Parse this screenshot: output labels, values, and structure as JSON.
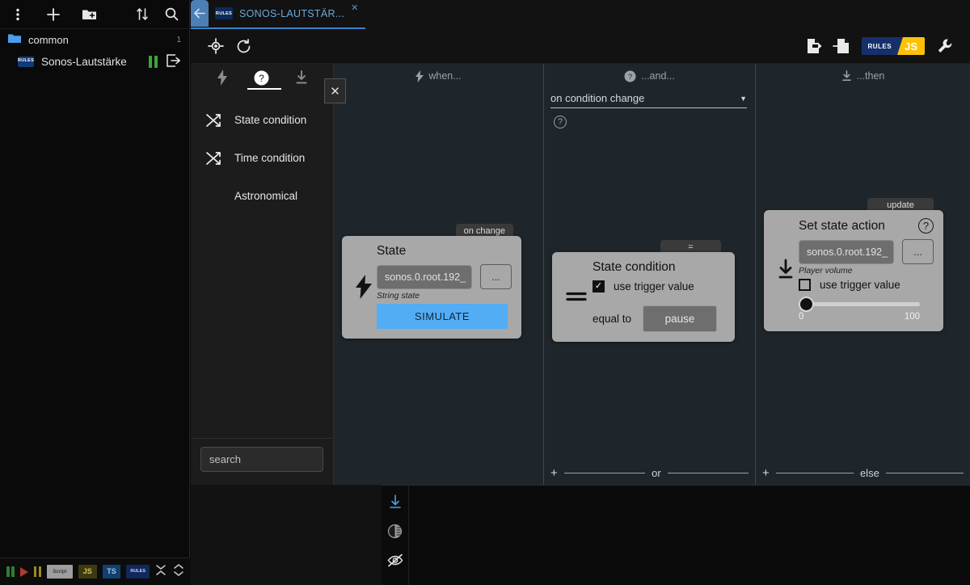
{
  "sidebar": {
    "toolbar": [
      {
        "name": "more-vert-icon",
        "label": "⋮"
      },
      {
        "name": "add-icon",
        "label": "+"
      },
      {
        "name": "new-folder-icon",
        "label": "folder+"
      },
      {
        "name": "sort-icon",
        "label": "sort"
      },
      {
        "name": "search-icon",
        "label": "search"
      }
    ],
    "folder": {
      "label": "common",
      "count": "1"
    },
    "items": [
      {
        "label": "Sonos-Lautstärke",
        "badge": "RULES",
        "state": "paused"
      }
    ]
  },
  "statusbar": {
    "badges": [
      "Script",
      "JS",
      "TS",
      "RULES"
    ],
    "script_label": "Script",
    "js_label": "JS",
    "ts_label": "TS",
    "rules_label": "RULES"
  },
  "tab": {
    "title": "SONOS-LAUTSTÄR...",
    "badge": "RULES",
    "close": "✕"
  },
  "toolbar": {
    "rules_label": "RULES",
    "js_label": "JS"
  },
  "left_panel": {
    "tabs": [
      {
        "name": "trigger-tab",
        "icon": "lightning-icon",
        "active": false
      },
      {
        "name": "condition-tab",
        "icon": "question-circle-icon",
        "active": true
      },
      {
        "name": "action-tab",
        "icon": "download-icon",
        "active": false
      }
    ],
    "items": [
      {
        "label": "State condition",
        "icon": "shuffle-icon"
      },
      {
        "label": "Time condition",
        "icon": "shuffle-icon"
      },
      {
        "label": "Astronomical",
        "icon": "moon-icon"
      }
    ],
    "search_placeholder": "search"
  },
  "columns": {
    "when": {
      "header": "when...",
      "close": "✕"
    },
    "and": {
      "header": "...and...",
      "select_value": "on condition change",
      "caret": "▼",
      "help": "?",
      "footer": {
        "plus": "+",
        "label": "or"
      }
    },
    "then": {
      "header": "...then",
      "footer": {
        "plus": "+",
        "label": "else"
      }
    }
  },
  "blocks": {
    "state_trigger": {
      "tab_label": "on change",
      "title": "State",
      "object_id": "sonos.0.root.192_",
      "dots": "...",
      "sub_label": "String state",
      "simulate_label": "SIMULATE"
    },
    "state_condition": {
      "tab_label": "=",
      "title": "State condition",
      "checkbox_label": "use trigger value",
      "checkbox_checked": true,
      "operator_label": "equal to",
      "value": "pause"
    },
    "set_state_action": {
      "tab_label": "update",
      "title": "Set state action",
      "help": "?",
      "object_id": "sonos.0.root.192_",
      "dots": "...",
      "sub_label": "Player volume",
      "checkbox_label": "use trigger value",
      "checkbox_checked": false,
      "slider_min": "0",
      "slider_max": "100",
      "slider_value": 0
    }
  },
  "debug_panel": {
    "icons": [
      "download-to-line-icon",
      "contrast-icon",
      "eye-off-icon"
    ]
  },
  "colors": {
    "accent_blue": "#3b82c4",
    "card_gray": "#a8a8a8",
    "simulate_blue": "#52adf5",
    "canvas": "#1e262b",
    "js_yellow": "#ffc107"
  }
}
